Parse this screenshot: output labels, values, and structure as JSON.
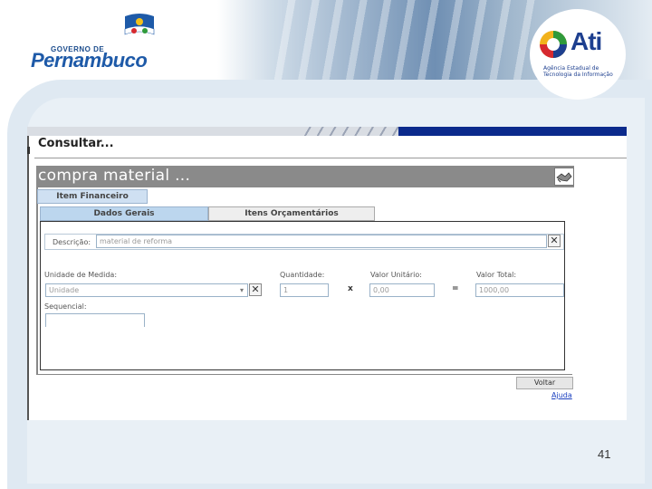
{
  "slide": {
    "page_number": "41",
    "logo_left": {
      "line1": "GOVERNO DE",
      "line2": "Pernambuco"
    },
    "logo_right": {
      "text": "Ati",
      "subtitle": "Agência Estadual de Tecnologia da Informação"
    }
  },
  "app": {
    "heading": "Consultar...",
    "window_title": "compra material ...",
    "tabs": {
      "top": "Item Financeiro",
      "sub_active": "Dados Gerais",
      "sub_other": "Itens Orçamentários"
    },
    "form": {
      "descricao_label": "Descrição:",
      "descricao_value": "material de reforma",
      "unidade_label": "Unidade de Medida:",
      "unidade_value": "Unidade",
      "quantidade_label": "Quantidade:",
      "quantidade_value": "1",
      "valor_unitario_label": "Valor Unitário:",
      "valor_unitario_value": "0,00",
      "valor_total_label": "Valor Total:",
      "valor_total_value": "1000,00",
      "sequencial_label": "Sequencial:",
      "times_symbol": "x",
      "equals_symbol": "="
    },
    "buttons": {
      "voltar": "Voltar",
      "ajuda": "Ajuda"
    },
    "icons": {
      "clear": "close-icon",
      "dropdown": "chevron-down-icon",
      "title_icon": "handshake-icon"
    }
  }
}
